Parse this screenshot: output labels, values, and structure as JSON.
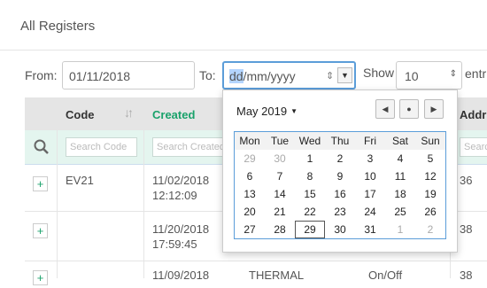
{
  "header": {
    "title": "All Registers"
  },
  "filters": {
    "from_label": "From:",
    "from_value": "01/11/2018",
    "to_label": "To:",
    "to_value_selected": "dd",
    "to_value_rest": "/mm/yyyy",
    "show_label": "Show",
    "show_value": "10",
    "entries_label": "entr"
  },
  "table": {
    "columns": {
      "code": "Code",
      "created": "Created",
      "address": "Addr"
    },
    "search": {
      "code_placeholder": "Search Code",
      "created_placeholder": "Search Created",
      "address_placeholder": "Searc"
    },
    "rows": [
      {
        "code": "EV21",
        "created_date": "11/02/2018",
        "created_time": "12:12:09",
        "address": "36"
      },
      {
        "code": "",
        "created_date": "11/20/2018",
        "created_time": "17:59:45",
        "address": "38"
      },
      {
        "code": "",
        "created_date": "11/09/2018",
        "created_time": "",
        "type": "THERMAL",
        "mode": "On/Off",
        "address": "38"
      }
    ]
  },
  "datepicker": {
    "month_label": "May 2019",
    "weekdays": [
      "Mon",
      "Tue",
      "Wed",
      "Thu",
      "Fri",
      "Sat",
      "Sun"
    ],
    "weeks": [
      [
        "29",
        "30",
        "1",
        "2",
        "3",
        "4",
        "5"
      ],
      [
        "6",
        "7",
        "8",
        "9",
        "10",
        "11",
        "12"
      ],
      [
        "13",
        "14",
        "15",
        "16",
        "17",
        "18",
        "19"
      ],
      [
        "20",
        "21",
        "22",
        "23",
        "24",
        "25",
        "26"
      ],
      [
        "27",
        "28",
        "29",
        "30",
        "31",
        "1",
        "2"
      ]
    ],
    "today": "29"
  }
}
